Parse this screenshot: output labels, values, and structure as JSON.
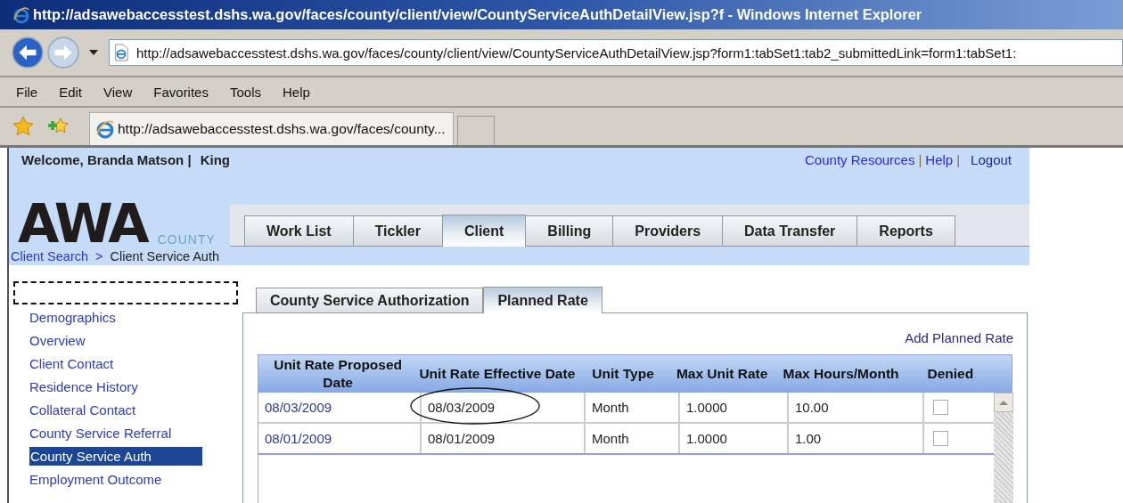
{
  "window": {
    "title": "http://adsawebaccesstest.dshs.wa.gov/faces/county/client/view/CountyServiceAuthDetailView.jsp?f - Windows Internet Explorer"
  },
  "address_bar": {
    "value": "http://adsawebaccesstest.dshs.wa.gov/faces/county/client/view/CountyServiceAuthDetailView.jsp?form1:tabSet1:tab2_submittedLink=form1:tabSet1:"
  },
  "menu": [
    "File",
    "Edit",
    "View",
    "Favorites",
    "Tools",
    "Help"
  ],
  "browser_tabs": [
    {
      "label": "http://adsawebaccesstest.dshs.wa.gov/faces/county..."
    }
  ],
  "header": {
    "welcome": "Welcome, Branda Matson |",
    "county": "King",
    "links": [
      {
        "kind": "link",
        "label": "County Resources"
      },
      {
        "kind": "separator",
        "label": "|"
      },
      {
        "kind": "link",
        "label": "Help"
      },
      {
        "kind": "separator",
        "label": "|"
      },
      {
        "kind": "plain",
        "label": "Logout"
      }
    ]
  },
  "logo": {
    "text": "AWA",
    "subtitle": "COUNTY"
  },
  "nav_tabs": [
    {
      "label": "Work List",
      "selected": false
    },
    {
      "label": "Tickler",
      "selected": false
    },
    {
      "label": "Client",
      "selected": true
    },
    {
      "label": "Billing",
      "selected": false
    },
    {
      "label": "Providers",
      "selected": false
    },
    {
      "label": "Data Transfer",
      "selected": false
    },
    {
      "label": "Reports",
      "selected": false
    }
  ],
  "breadcrumb": [
    {
      "kind": "link",
      "label": "Client Search"
    },
    {
      "kind": "separator",
      "label": ">"
    },
    {
      "kind": "current",
      "label": "Client Service Auth"
    }
  ],
  "sidebar": {
    "items": [
      {
        "label": "Demographics",
        "selected": false
      },
      {
        "label": "Overview",
        "selected": false
      },
      {
        "label": "Client Contact",
        "selected": false
      },
      {
        "label": "Residence History",
        "selected": false
      },
      {
        "label": "Collateral Contact",
        "selected": false
      },
      {
        "label": "County Service Referral",
        "selected": false
      },
      {
        "label": "County Service Auth",
        "selected": true
      },
      {
        "label": "Employment Outcome",
        "selected": false
      }
    ]
  },
  "subtabs": [
    {
      "label": "County Service Authorization",
      "selected": false
    },
    {
      "label": "Planned Rate",
      "selected": true
    }
  ],
  "add_link": "Add Planned Rate",
  "table": {
    "columns": [
      "Unit Rate Proposed Date",
      "Unit Rate Effective Date",
      "Unit Type",
      "Max Unit Rate",
      "Max Hours/Month",
      "Denied"
    ],
    "rows": [
      {
        "cells": [
          "08/03/2009",
          "08/03/2009",
          "Month",
          "1.0000",
          "10.00"
        ],
        "denied": false,
        "circled": true
      },
      {
        "cells": [
          "08/01/2009",
          "08/01/2009",
          "Month",
          "1.0000",
          "1.00"
        ],
        "denied": false,
        "circled": false
      }
    ]
  }
}
